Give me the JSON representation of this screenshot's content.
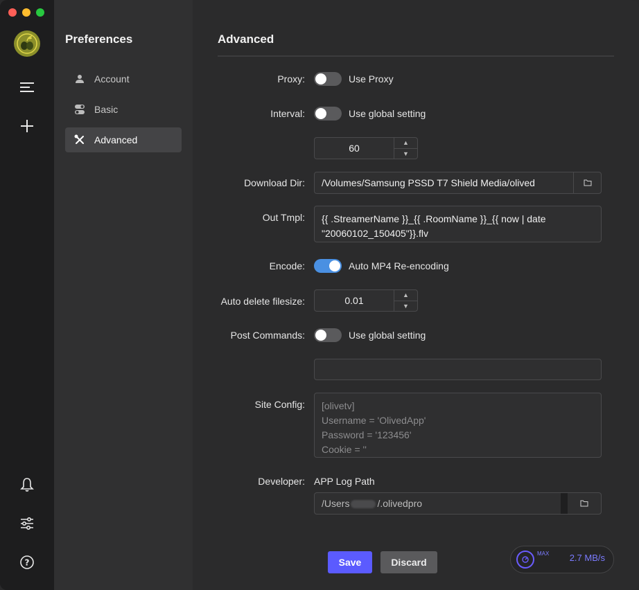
{
  "sidebar": {
    "title": "Preferences",
    "items": [
      {
        "label": "Account",
        "icon": "person-icon"
      },
      {
        "label": "Basic",
        "icon": "toggle-icon"
      },
      {
        "label": "Advanced",
        "icon": "tools-icon",
        "active": true
      }
    ]
  },
  "rail": {
    "icons": [
      "olive-logo-icon",
      "menu-icon",
      "plus-icon",
      "bell-icon",
      "sliders-icon",
      "help-icon"
    ]
  },
  "main": {
    "title": "Advanced",
    "proxy": {
      "label": "Proxy:",
      "toggle_text": "Use Proxy",
      "on": false
    },
    "interval": {
      "label": "Interval:",
      "toggle_text": "Use global setting",
      "on": false,
      "value": "60"
    },
    "download_dir": {
      "label": "Download Dir:",
      "value": "/Volumes/Samsung PSSD T7 Shield Media/olived"
    },
    "out_tmpl": {
      "label": "Out Tmpl:",
      "value": "{{ .StreamerName }}_{{ .RoomName }}_{{ now | date \"20060102_150405\"}}.flv"
    },
    "encode": {
      "label": "Encode:",
      "toggle_text": "Auto MP4 Re-encoding",
      "on": true
    },
    "auto_delete": {
      "label": "Auto delete filesize:",
      "value": "0.01"
    },
    "post_commands": {
      "label": "Post Commands:",
      "toggle_text": "Use global setting",
      "on": false,
      "value": ""
    },
    "site_config": {
      "label": "Site Config:",
      "lines": [
        "[olivetv]",
        "Username = 'OlivedApp'",
        "Password = '123456'",
        "Cookie = ''"
      ]
    },
    "developer": {
      "label": "Developer:",
      "text": "APP Log Path",
      "path_prefix": "/Users",
      "path_suffix": "/.olivedpro"
    },
    "buttons": {
      "save": "Save",
      "discard": "Discard"
    }
  },
  "speed": {
    "max_label": "MAX",
    "value": "2.7 MB/s"
  },
  "colors": {
    "accent": "#5b5bff",
    "toggle_on": "#4a90e2",
    "speed": "#7b7bff"
  }
}
